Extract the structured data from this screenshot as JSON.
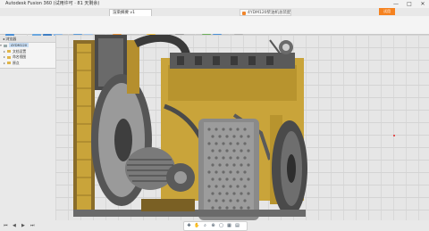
{
  "window": {
    "title": "Autodesk Fusion 360 (试用许可 · 81 天剩余)",
    "min": "—",
    "max": "□",
    "close": "✕"
  },
  "tabs": {
    "active": "渲染摘要 v1",
    "secondary": "4YDM120柴油机总装配",
    "trial_badge": "试用"
  },
  "ribbon": {
    "sections": [
      "设计 ▾",
      "创建 ▾",
      "修改 ▾",
      "装配 ▾",
      "构造 ▾",
      "检验 ▾",
      "插入 ▾",
      "选择 ▾"
    ]
  },
  "browser": {
    "header": "◂ 浏览器",
    "items": [
      {
        "label": "4YDM120",
        "selected": true
      },
      {
        "label": "文档设置",
        "selected": false
      },
      {
        "label": "命名视图",
        "selected": false
      },
      {
        "label": "原点",
        "selected": false
      },
      {
        "label": "装配",
        "selected": false
      }
    ]
  },
  "navbar": {
    "icons": [
      "✥",
      "✋",
      "⌕",
      "⊕",
      "▢",
      "▦",
      "▤"
    ]
  },
  "timeline": {
    "controls": [
      "⏮",
      "◀",
      "▶",
      "⏭"
    ]
  },
  "colors": {
    "engine_body": "#c9a43a",
    "engine_dark": "#3a3a3a",
    "accent": "#f58220",
    "selection": "#c6dcf3"
  }
}
